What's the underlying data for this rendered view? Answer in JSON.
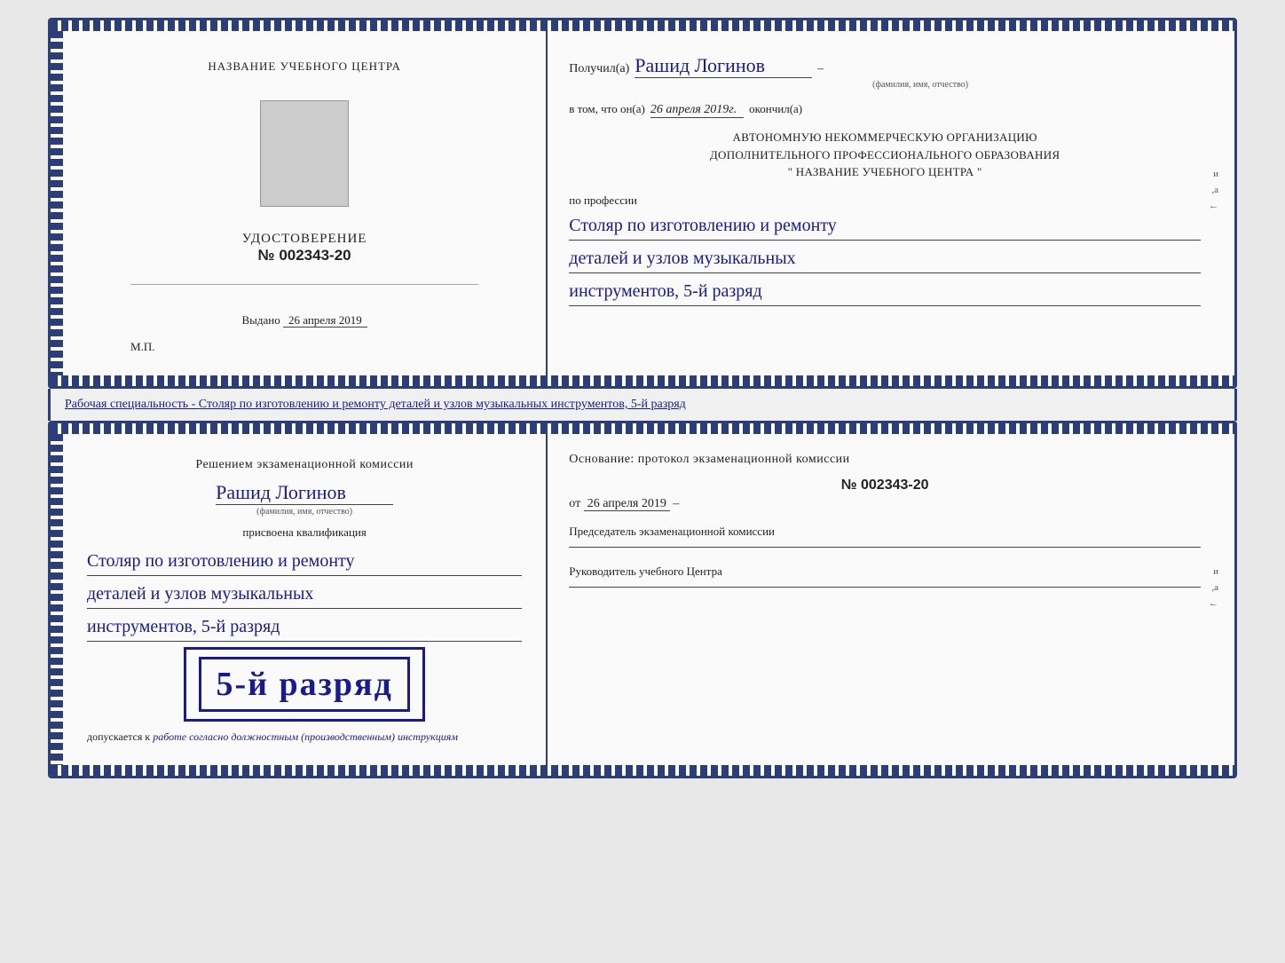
{
  "doc1": {
    "left": {
      "school_name": "НАЗВАНИЕ УЧЕБНОГО ЦЕНТРА",
      "udostoverenie_label": "УДОСТОВЕРЕНИЕ",
      "number": "№ 002343-20",
      "vydano_label": "Выдано",
      "vydano_date": "26 апреля 2019",
      "mp_label": "М.П."
    },
    "right": {
      "poluchil_prefix": "Получил(а)",
      "recipient_name": "Рашид Логинов",
      "fio_label": "(фамилия, имя, отчество)",
      "dash": "–",
      "vtom_prefix": "в том, что он(а)",
      "vtom_date": "26 апреля 2019г.",
      "okonchil": "окончил(а)",
      "avtonom_line1": "АВТОНОМНУЮ НЕКОММЕРЧЕСКУЮ ОРГАНИЗАЦИЮ",
      "avtonom_line2": "ДОПОЛНИТЕЛЬНОГО ПРОФЕССИОНАЛЬНОГО ОБРАЗОВАНИЯ",
      "avtonom_line3": "\"  НАЗВАНИЕ УЧЕБНОГО ЦЕНТРА  \"",
      "po_professii_label": "по профессии",
      "profession_line1": "Столяр по изготовлению и ремонту",
      "profession_line2": "деталей и узлов музыкальных",
      "profession_line3": "инструментов, 5-й разряд"
    }
  },
  "specialty_bar": {
    "prefix": "Рабочая специальность - ",
    "specialty": "Столяр по изготовлению и ремонту деталей и узлов музыкальных инструментов, 5-й разряд"
  },
  "doc2": {
    "left": {
      "resheniem_label": "Решением экзаменационной комиссии",
      "recipient_name": "Рашид Логинов",
      "fio_label": "(фамилия, имя, отчество)",
      "prisvoena_label": "присвоена квалификация",
      "profession_line1": "Столяр по изготовлению и ремонту",
      "profession_line2": "деталей и узлов музыкальных",
      "profession_line3": "инструментов, 5-й разряд",
      "rank_badge": "5-й разряд",
      "dopuskaetsya_prefix": "допускается к",
      "dopuskaetsya_text": "работе согласно должностным (производственным) инструкциям"
    },
    "right": {
      "osnovanie_label": "Основание: протокол экзаменационной комиссии",
      "protocol_number": "№  002343-20",
      "ot_prefix": "от",
      "ot_date": "26 апреля 2019",
      "chairman_label": "Председатель экзаменационной комиссии",
      "rukovoditel_label": "Руководитель учебного Центра"
    }
  }
}
